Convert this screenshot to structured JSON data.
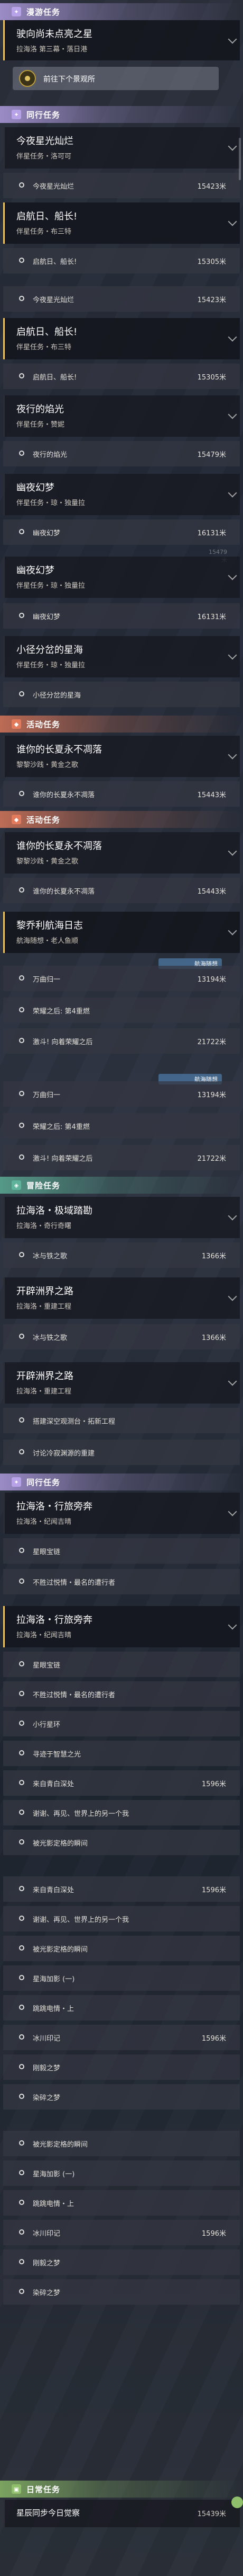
{
  "sections": {
    "trailblaze": {
      "title": "漫游任务",
      "icon": "✦",
      "color": "#b7a2e8"
    },
    "companion": {
      "title": "同行任务",
      "icon": "✦",
      "color": "#b7a2e8"
    },
    "event": {
      "title": "活动任务",
      "icon": "◆",
      "color": "#e27b5c"
    },
    "adventure": {
      "title": "冒险任务",
      "icon": "◈",
      "color": "#5fb39a"
    },
    "daily": {
      "title": "日常任务",
      "icon": "▣",
      "color": "#8fbf6a"
    }
  },
  "items": {
    "c0": {
      "title": "驶向尚未点亮之星",
      "sub": "拉海洛 第三幕・落日港"
    },
    "btn0": {
      "label": "前往下个景观所"
    },
    "c1": {
      "title": "今夜星光灿烂",
      "sub": "伴星任务・洛可可"
    },
    "o1": {
      "text": "今夜星光灿烂",
      "dist": "15423米"
    },
    "c2": {
      "title": "启航日、船长!",
      "sub": "伴星任务・布三特"
    },
    "o2": {
      "text": "启航日、船长!",
      "dist": "15305米"
    },
    "o2b": {
      "text": "今夜星光灿烂",
      "dist": "15423米"
    },
    "c3": {
      "title": "启航日、船长!",
      "sub": "伴星任务・布三特"
    },
    "o3": {
      "text": "启航日、船长!",
      "dist": "15305米"
    },
    "c4": {
      "title": "夜行的焰光",
      "sub": "伴星任务・赞妮"
    },
    "o4": {
      "text": "夜行的焰光",
      "dist": "15479米"
    },
    "c5": {
      "title": "幽夜幻梦",
      "sub": "伴星任务・琼・独量拉"
    },
    "o5": {
      "text": "幽夜幻梦",
      "dist": "16131米"
    },
    "g5": "15479米",
    "c6": {
      "title": "幽夜幻梦",
      "sub": "伴星任务・琼・独量拉"
    },
    "o6": {
      "text": "幽夜幻梦",
      "dist": "16131米"
    },
    "c7": {
      "title": "小径分岔的星海",
      "sub": "伴星任务・琼・独量拉"
    },
    "o7": {
      "text": "小径分岔的星海",
      "dist": ""
    },
    "c8": {
      "title": "谁你的长夏永不凋落",
      "sub": "黎黎沙践・黄金之歌"
    },
    "o8": {
      "text": "谁你的长夏永不凋落",
      "dist": "15443米"
    },
    "c9": {
      "title": "谁你的长夏永不凋落",
      "sub": "黎黎沙践・黄金之歌"
    },
    "o9": {
      "text": "谁你的长夏永不凋落",
      "dist": "15443米"
    },
    "c10": {
      "title": "黎乔利航海日志",
      "sub": "航海随想・老人鱼顺"
    },
    "tag10": "航海随想",
    "o10a": {
      "text": "万曲归一",
      "dist": "13194米"
    },
    "o10b": {
      "text": "荣耀之后: 第4重燃",
      "dist": ""
    },
    "o10c": {
      "text": "激斗! 向着荣耀之后",
      "dist": "21722米"
    },
    "tag10b": "航海随想",
    "o10d": {
      "text": "万曲归一",
      "dist": "13194米"
    },
    "o10e": {
      "text": "荣耀之后: 第4重燃",
      "dist": ""
    },
    "o10f": {
      "text": "激斗! 向着荣耀之后",
      "dist": "21722米"
    },
    "c11": {
      "title": "拉海洛・极域踏勘",
      "sub": "拉海洛・奇行奇曙"
    },
    "o11": {
      "text": "冰与铁之歌",
      "dist": "1366米"
    },
    "c12": {
      "title": "开辟洲界之路",
      "sub": "拉海洛・重建工程"
    },
    "o12": {
      "text": "冰与铁之歌",
      "dist": "1366米"
    },
    "c13": {
      "title": "开辟洲界之路",
      "sub": "拉海洛・重建工程"
    },
    "o13a": {
      "text": "搭建深空观测台・拓新工程",
      "dist": ""
    },
    "o13b": {
      "text": "讨论冷寂渊源的重建",
      "dist": ""
    },
    "c14": {
      "title": "拉海洛・行旅旁奔",
      "sub": "拉海洛・纪闻吉晴"
    },
    "o14a": {
      "text": "星眼宝链",
      "dist": ""
    },
    "o14b": {
      "text": "不胜过悦情・最名的遭行者",
      "dist": ""
    },
    "c15": {
      "title": "拉海洛・行旅旁奔",
      "sub": "拉海洛・纪闻吉晴"
    },
    "o15a": {
      "text": "星眼宝链",
      "dist": ""
    },
    "o15b": {
      "text": "不胜过悦情・最名的遭行者",
      "dist": ""
    },
    "o15c": {
      "text": "小行星环",
      "dist": ""
    },
    "o15d": {
      "text": "寻迹于智慧之光",
      "dist": ""
    },
    "o15e": {
      "text": "来自青白深处",
      "dist": "1596米"
    },
    "o15f": {
      "text": "谢谢、再见、世界上的另一个我",
      "dist": ""
    },
    "o15g": {
      "text": "被光影定格的瞬间",
      "dist": ""
    },
    "o15h": {
      "text": "来自青白深处",
      "dist": "1596米"
    },
    "o15i": {
      "text": "谢谢、再见、世界上的另一个我",
      "dist": ""
    },
    "o15j": {
      "text": "被光影定格的瞬间",
      "dist": ""
    },
    "o15k": {
      "text": "星海加影 (一)",
      "dist": ""
    },
    "o15l": {
      "text": "跳跳电情・上",
      "dist": ""
    },
    "o15m": {
      "text": "冰川印记",
      "dist": "1596米"
    },
    "o15n": {
      "text": "刚毅之梦",
      "dist": ""
    },
    "o15o": {
      "text": "染碎之梦",
      "dist": ""
    },
    "o15p": {
      "text": "被光影定格的瞬间",
      "dist": ""
    },
    "o15q": {
      "text": "星海加影 (一)",
      "dist": ""
    },
    "o15r": {
      "text": "跳跳电情・上",
      "dist": ""
    },
    "o15s": {
      "text": "冰川印记",
      "dist": "1596米"
    },
    "o15t": {
      "text": "刚毅之梦",
      "dist": ""
    },
    "o15u": {
      "text": "染碎之梦",
      "dist": ""
    },
    "c16": {
      "title": "星辰同步今日觉察",
      "sub": ""
    },
    "o16dist": "15439米"
  }
}
